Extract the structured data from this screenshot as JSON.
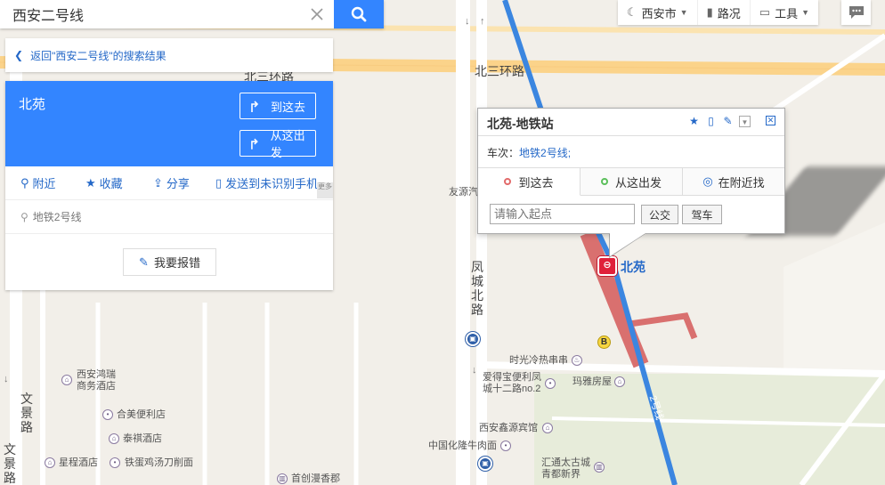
{
  "search": {
    "value": "西安二号线"
  },
  "back_link": {
    "label": "返回\"西安二号线\"的搜索结果"
  },
  "place": {
    "title": "北苑",
    "go_here": "到这去",
    "from_here": "从这出发",
    "actions": {
      "nearby": "附近",
      "favorite": "收藏",
      "share": "分享",
      "send_phone": "发送到未识别手机"
    },
    "more_tag": "更多",
    "line": "地铁2号线",
    "report": "我要报错"
  },
  "toolbar": {
    "city": "西安市",
    "traffic": "路况",
    "tools": "工具"
  },
  "info_window": {
    "title": "北苑-地铁站",
    "line_prefix": "车次：",
    "line_link": "地铁2号线;",
    "tabs": {
      "go_here": "到这去",
      "from_here": "从这出发",
      "nearby": "在附近找"
    },
    "start_placeholder": "请输入起点",
    "bus": "公交",
    "drive": "驾车"
  },
  "map": {
    "roads": {
      "n3ring_top": "北三环路",
      "n3ring_right": "北三环路",
      "fengcheng": "凤城北路",
      "wenjing_1": "文景路",
      "wenjing_2": "文景路",
      "line2": "2号线"
    },
    "station": "北苑",
    "pois": {
      "youyuan": "友源汽",
      "xian_hongrui_1": "西安鸿瑞",
      "xian_hongrui_2": "商务酒店",
      "hemei": "合美便利店",
      "taiqi": "泰祺酒店",
      "xingcheng": "星程酒店",
      "tiedan": "铁蛋鸡汤刀削面",
      "shouchuang": "首创漫香郡",
      "shiguang": "时光冷热串串",
      "aidebao_1": "爱得宝便利凤",
      "aidebao_2": "城十二路no.2",
      "maya": "玛雅房屋",
      "xinyuan": "西安鑫源宾馆",
      "zhonghua": "中国化隆牛肉面",
      "huitong_1": "汇通太古城",
      "huitong_2": "青都新界"
    }
  },
  "colors": {
    "accent": "#3385ff",
    "link": "#2468c8",
    "metro_line": "#3b86e0",
    "metro_station": "#e0203a"
  }
}
